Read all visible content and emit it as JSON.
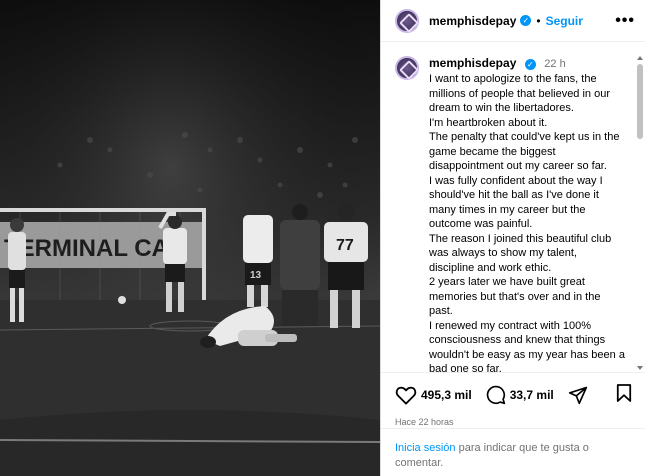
{
  "post": {
    "image_alt": "",
    "jersey_number_1": "13",
    "jersey_number_2": "77",
    "ad_board_text": "TERMINAL CA"
  },
  "header": {
    "username": "memphisdepay",
    "separator": "•",
    "follow_label": "Seguir",
    "more_label": "•••"
  },
  "caption": {
    "username": "memphisdepay",
    "time": "22 h",
    "lines": [
      "I want to apologize to the fans, the",
      "millions of people that believed in our",
      "dream to win the libertadores.",
      "I'm heartbroken about it.",
      "The penalty that could've kept us in the",
      "game became the biggest",
      "disappointment out my career so far.",
      "I was fully confident about the way I",
      "should've hit the ball as I've done it",
      "many times in my career but the",
      "outcome was painful.",
      "The reason I joined this beautiful club",
      "was always to show my talent,",
      "discipline and work ethic.",
      "2 years later we have built great",
      "memories but that's over and in the",
      "past.",
      "I renewed my contract with 100%",
      "consciousness and knew that things",
      "wouldn't be easy as my year has been a",
      "bad one so far."
    ]
  },
  "actions": {
    "likes": "495,3 mil",
    "comments": "33,7 mil",
    "icons": [
      "heart-icon",
      "comment-icon",
      "share-icon",
      "bookmark-icon"
    ]
  },
  "timestamp": "Hace 22 horas",
  "login": {
    "link_label": "Inicia sesión",
    "rest": " para indicar que te gusta o comentar."
  },
  "colors": {
    "accent": "#0095f6",
    "muted": "#737373",
    "photo_bg": "#141414"
  }
}
